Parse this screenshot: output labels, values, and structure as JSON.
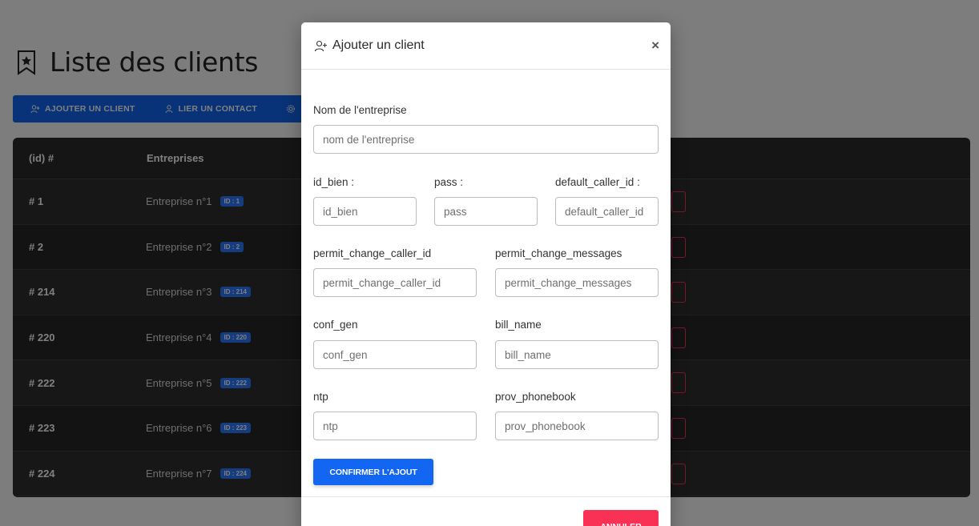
{
  "page": {
    "title": "Liste des clients",
    "toolbar": {
      "add_client": "AJOUTER UN CLIENT",
      "link_contact": "LIER UN CONTACT"
    },
    "table": {
      "headers": [
        "(id) #",
        "Entreprises"
      ],
      "rows": [
        {
          "id": "# 1",
          "name": "Entreprise n°1",
          "badge": "ID : 1"
        },
        {
          "id": "# 2",
          "name": "Entreprise n°2",
          "badge": "ID : 2"
        },
        {
          "id": "# 214",
          "name": "Entreprise n°3",
          "badge": "ID : 214"
        },
        {
          "id": "# 220",
          "name": "Entreprise n°4",
          "badge": "ID : 220"
        },
        {
          "id": "# 222",
          "name": "Entreprise n°5",
          "badge": "ID : 222"
        },
        {
          "id": "# 223",
          "name": "Entreprise n°6",
          "badge": "ID : 223"
        },
        {
          "id": "# 224",
          "name": "Entreprise n°7",
          "badge": "ID : 224"
        }
      ]
    }
  },
  "modal": {
    "title": "Ajouter un client",
    "close": "×",
    "fields": {
      "company": {
        "label": "Nom de l'entreprise",
        "placeholder": "nom de l'entreprise"
      },
      "id_bien": {
        "label": "id_bien :",
        "placeholder": "id_bien"
      },
      "pass": {
        "label": "pass :",
        "placeholder": "pass"
      },
      "default_caller_id": {
        "label": "default_caller_id :",
        "placeholder": "default_caller_id"
      },
      "permit_change_caller_id": {
        "label": "permit_change_caller_id",
        "placeholder": "permit_change_caller_id"
      },
      "permit_change_messages": {
        "label": "permit_change_messages",
        "placeholder": "permit_change_messages"
      },
      "conf_gen": {
        "label": "conf_gen",
        "placeholder": "conf_gen"
      },
      "bill_name": {
        "label": "bill_name",
        "placeholder": "bill_name"
      },
      "ntp": {
        "label": "ntp",
        "placeholder": "ntp"
      },
      "prov_phonebook": {
        "label": "prov_phonebook",
        "placeholder": "prov_phonebook"
      }
    },
    "confirm": "CONFIRMER L'AJOUT",
    "cancel": "ANNULER"
  },
  "colors": {
    "primary": "#1266f1",
    "danger": "#f93154",
    "table_dark": "#2b2b2b"
  },
  "icons": [
    "bookmark-star-icon",
    "user-plus-icon",
    "user-icon",
    "gear-icon",
    "close-icon"
  ]
}
